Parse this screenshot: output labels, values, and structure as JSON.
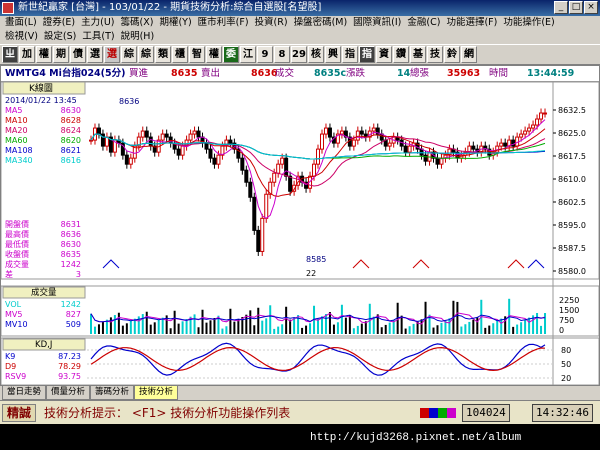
{
  "window": {
    "title": "新世紀贏家 [台灣] - 103/01/22 - 期貨技術分析:綜合自選股[名望股]",
    "buttons": [
      "_",
      "□",
      "×"
    ]
  },
  "menu": {
    "row1": [
      "畫面(L)",
      "證券(E)",
      "主力(U)",
      "籌碼(X)",
      "期權(Y)",
      "匯市利率(F)",
      "投資(R)",
      "操盤密碼(M)",
      "國際資訊(I)",
      "金融(C)",
      "功能選擇(F)",
      "功能操作(E)"
    ],
    "row2": [
      "檢視(V)",
      "設定(S)",
      "工具(T)",
      "說明(H)"
    ]
  },
  "toolbar": {
    "buttons": [
      "ㄓ",
      "加",
      "權",
      "期",
      "債",
      "選",
      "選",
      "綜",
      "綜",
      "類",
      "櫃",
      "智",
      "權",
      "委",
      "江",
      "9",
      "8",
      "29",
      "核",
      "興",
      "指",
      "指",
      "資",
      "鑽",
      "基",
      "技",
      "鈴",
      "網"
    ]
  },
  "stock": {
    "code": "WMTG4 Mi台指024(5分)",
    "bid_label": "買進",
    "bid": "8635",
    "ask_label": "賣出",
    "ask": "8636",
    "deal_label": "成交",
    "deal": "8635c",
    "change_label": "漲跌",
    "change": "14",
    "volume_label": "總張",
    "volume": "35963",
    "time_label": "時間",
    "time": "13:44:59"
  },
  "kline_panel": {
    "title": "K線圖",
    "date": "2014/01/22 13:45",
    "ma": [
      {
        "name": "MA5",
        "value": "8630",
        "color": "#cc00cc"
      },
      {
        "name": "MA10",
        "value": "8628",
        "color": "#cc0000"
      },
      {
        "name": "MA20",
        "value": "8624",
        "color": "#cc0066"
      },
      {
        "name": "MA60",
        "value": "8620",
        "color": "#00aa00"
      },
      {
        "name": "MA108",
        "value": "8621",
        "color": "#0000cc"
      },
      {
        "name": "MA340",
        "value": "8616",
        "color": "#00cccc"
      }
    ],
    "ohlc": [
      {
        "name": "開盤價",
        "value": "8631"
      },
      {
        "name": "最高價",
        "value": "8636"
      },
      {
        "name": "最低價",
        "value": "8630"
      },
      {
        "name": "收盤價",
        "value": "8635"
      },
      {
        "name": "成交量",
        "value": "1242"
      },
      {
        "name": "差",
        "value": "3"
      }
    ],
    "high_mark": "8636",
    "low_mark": "8585",
    "date_mark": "22",
    "yticks": [
      "8632.5",
      "8625.0",
      "8617.5",
      "8610.0",
      "8602.5",
      "8595.0",
      "8587.5",
      "8580.0"
    ]
  },
  "vol_panel": {
    "title": "成交量",
    "rows": [
      {
        "name": "VOL",
        "value": "1242",
        "color": "#00cccc"
      },
      {
        "name": "MV5",
        "value": "827",
        "color": "#cc00cc"
      },
      {
        "name": "MV10",
        "value": "509",
        "color": "#0000cc"
      }
    ],
    "yticks": [
      "2250",
      "1500",
      "750",
      "0"
    ]
  },
  "kd_panel": {
    "title": "KD,J",
    "rows": [
      {
        "name": "K9",
        "value": "87.23",
        "color": "#0000cc"
      },
      {
        "name": "D9",
        "value": "78.29",
        "color": "#cc0000"
      },
      {
        "name": "RSV9",
        "value": "93.75",
        "color": "#cc00cc"
      }
    ],
    "yticks": [
      "80",
      "50",
      "20"
    ]
  },
  "tabs": [
    "當日走勢",
    "價量分析",
    "籌碼分析",
    "技術分析"
  ],
  "prompt": {
    "button": "精誠",
    "text": "技術分析提示： <F1> 技術分析功能操作列表",
    "code": "104024",
    "clock": "14:32:46"
  },
  "watermark": "http://kujd3268.pixnet.net/album"
}
